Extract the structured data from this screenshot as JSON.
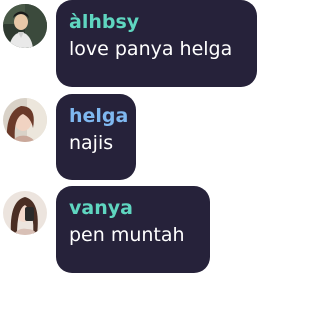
{
  "messages": [
    {
      "username": "àlhbsy",
      "text": "love panya helga",
      "name_color": "#5fd6c0"
    },
    {
      "username": "helga",
      "text": "najis",
      "name_color": "#7fb8f0"
    },
    {
      "username": "vanya",
      "text": "pen muntah",
      "name_color": "#5fd6c0"
    }
  ]
}
